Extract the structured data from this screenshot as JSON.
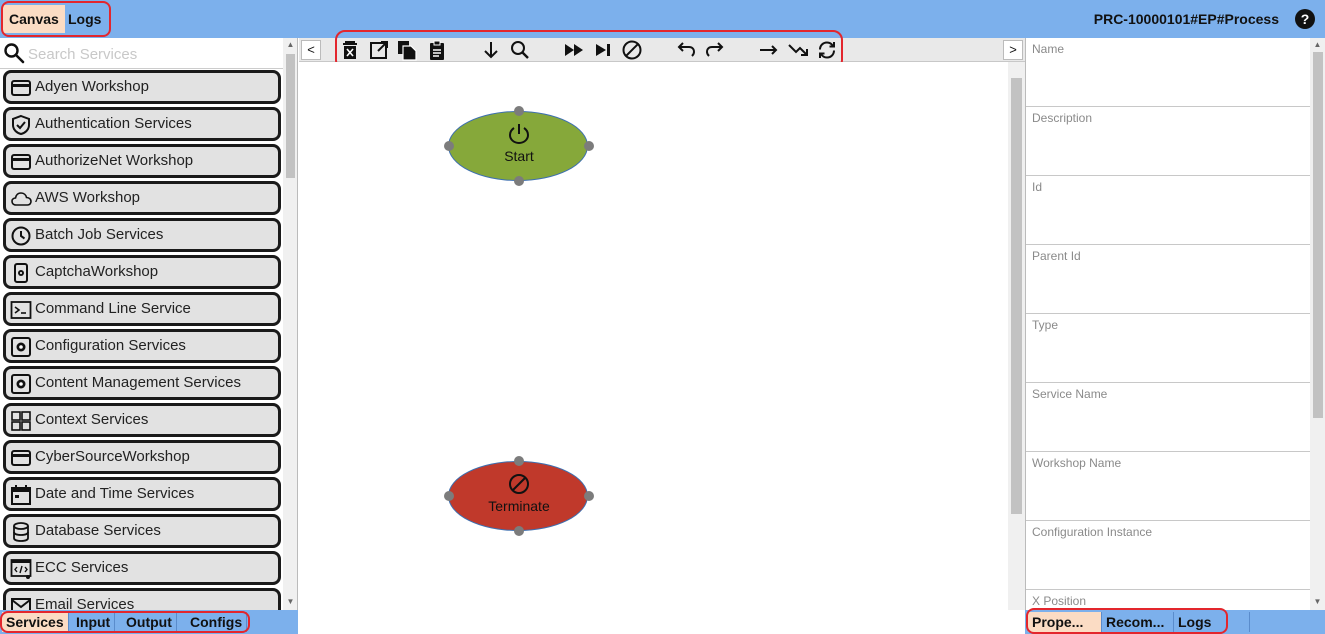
{
  "top_tabs": [
    {
      "label": "Canvas",
      "active": true
    },
    {
      "label": "Logs",
      "active": false
    }
  ],
  "process_id": "PRC-10000101#EP#Process",
  "help_icon": "?",
  "search": {
    "placeholder": "Search Services",
    "value": ""
  },
  "services": [
    {
      "label": "Adyen Workshop",
      "icon": "card-icon"
    },
    {
      "label": "Authentication Services",
      "icon": "shield-check-icon"
    },
    {
      "label": "AuthorizeNet Workshop",
      "icon": "card-icon"
    },
    {
      "label": "AWS Workshop",
      "icon": "cloud-icon"
    },
    {
      "label": "Batch Job Services",
      "icon": "clock-icon"
    },
    {
      "label": "CaptchaWorkshop",
      "icon": "phone-gear-icon"
    },
    {
      "label": "Command Line Service",
      "icon": "terminal-icon"
    },
    {
      "label": "Configuration Services",
      "icon": "settings-box-icon"
    },
    {
      "label": "Content Management Services",
      "icon": "settings-box-icon"
    },
    {
      "label": "Context Services",
      "icon": "grid-icon"
    },
    {
      "label": "CyberSourceWorkshop",
      "icon": "card-icon"
    },
    {
      "label": "Date and Time Services",
      "icon": "calendar-icon"
    },
    {
      "label": "Database Services",
      "icon": "database-icon"
    },
    {
      "label": "ECC Services",
      "icon": "code-window-icon"
    },
    {
      "label": "Email Services",
      "icon": "mail-icon"
    }
  ],
  "left_bottom_tabs": [
    {
      "label": "Services",
      "active": true
    },
    {
      "label": "Input",
      "active": false
    },
    {
      "label": "Output",
      "active": false
    },
    {
      "label": "Configs",
      "active": false
    }
  ],
  "toolbar": {
    "nav_left": "<",
    "nav_right": ">",
    "tools": [
      "delete-icon",
      "open-external-icon",
      "copy-icon",
      "paste-icon",
      "step-down-icon",
      "search-icon",
      "fast-forward-icon",
      "skip-next-icon",
      "block-icon",
      "undo-icon",
      "redo-icon",
      "arrow-right-icon",
      "trend-down-icon",
      "refresh-icon"
    ]
  },
  "nodes": [
    {
      "label": "Start",
      "icon": "power-icon"
    },
    {
      "label": "Terminate",
      "icon": "block-icon"
    }
  ],
  "properties": [
    "Name",
    "Description",
    "Id",
    "Parent Id",
    "Type",
    "Service Name",
    "Workshop Name",
    "Configuration Instance",
    "X Position"
  ],
  "right_bottom_tabs": [
    {
      "label": "Prope...",
      "active": true
    },
    {
      "label": "Recom...",
      "active": false
    },
    {
      "label": "Logs",
      "active": false
    }
  ],
  "colors": {
    "header": "#7cb0ec",
    "active_tab": "#fbdcc4",
    "start_node": "#86a83a",
    "terminate_node": "#c0392b",
    "annotation_outline": "#e3262d"
  }
}
